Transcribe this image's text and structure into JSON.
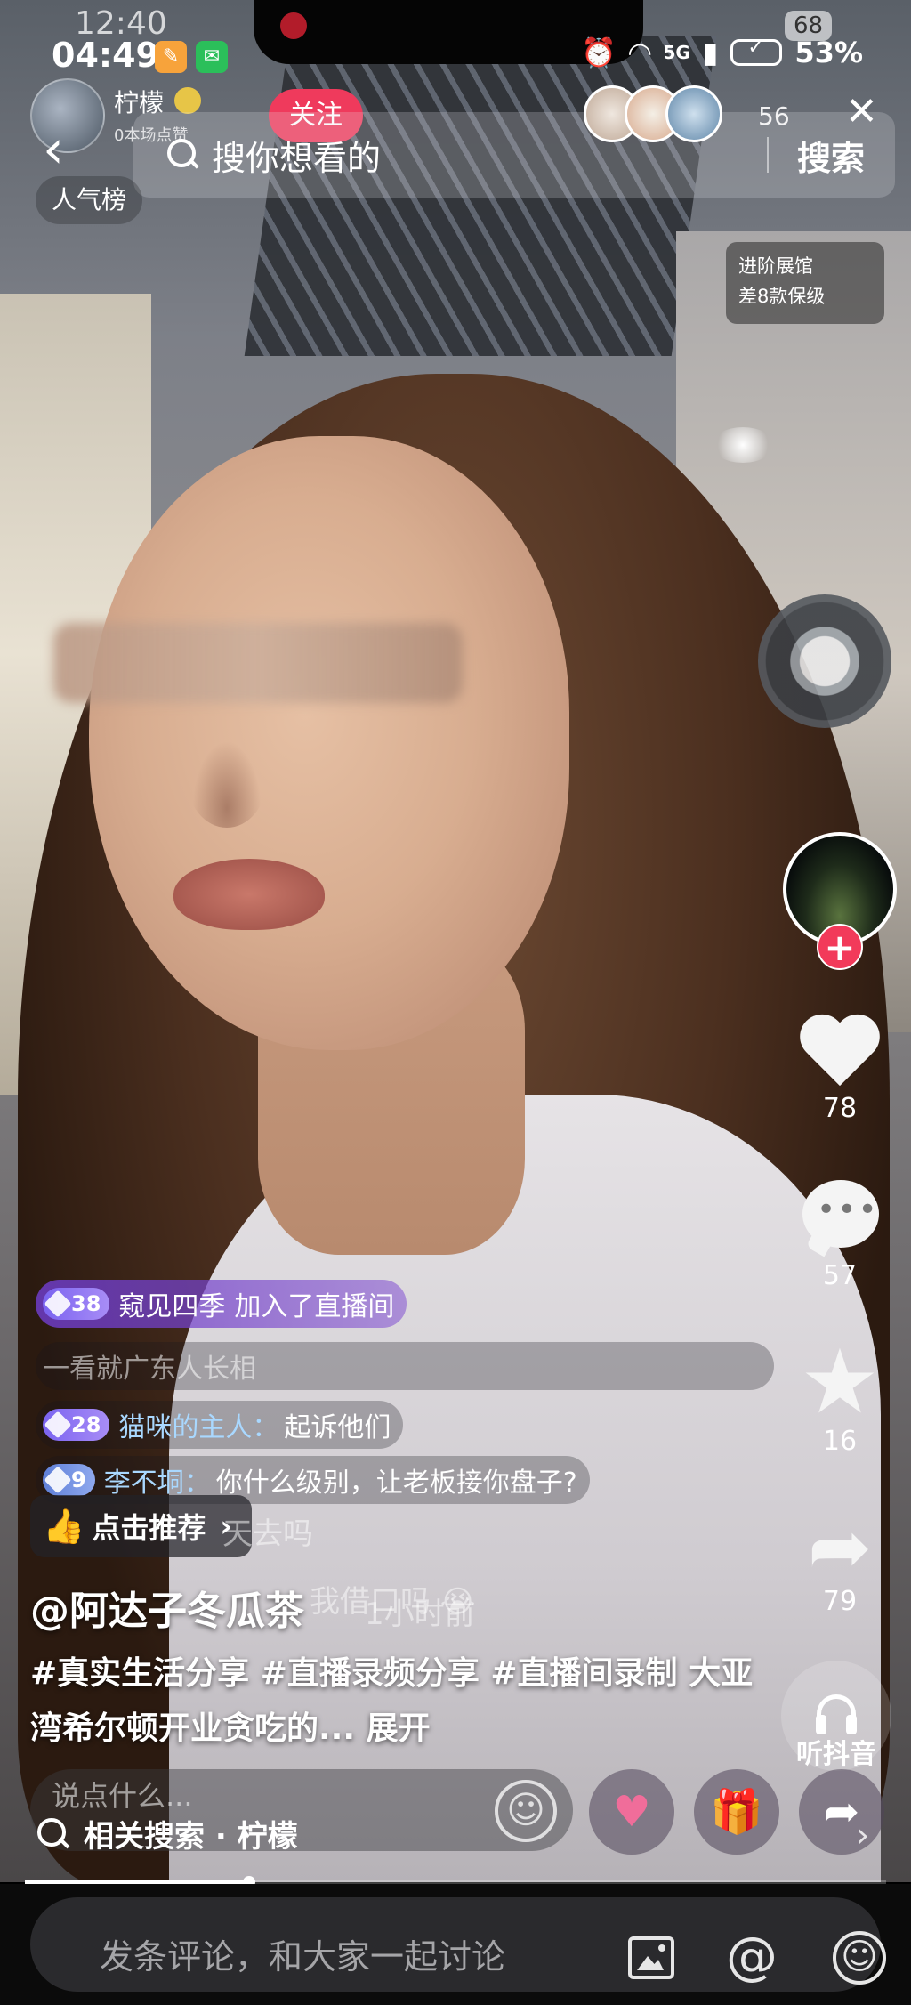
{
  "status_bar": {
    "ghost_time": "12:40",
    "time": "04:49",
    "ghost_battery": "68",
    "signal": "5G",
    "battery": "53%"
  },
  "live_header": {
    "anchor_name": "柠檬",
    "anchor_likes": "0本场点赞",
    "follow_label": "关注",
    "viewer_count": "56",
    "rank_label": "人气榜",
    "promo_line1": "进阶展馆",
    "promo_line2": "差8款保级"
  },
  "search": {
    "placeholder": "搜你想看的",
    "button_label": "搜索"
  },
  "actions": {
    "like_count": "78",
    "comment_count": "57",
    "favorite_count": "16",
    "share_count": "79",
    "listen_label": "听抖音",
    "plus": "+"
  },
  "chat": {
    "messages": [
      {
        "level": "38",
        "user": "窥见四季",
        "text": "加入了直播间"
      },
      {
        "level": "",
        "user": "",
        "text": "一看就广东人长相"
      },
      {
        "level": "28",
        "user": "猫咪的主人：",
        "text": "起诉他们"
      },
      {
        "level": "9",
        "user": "李不垌：",
        "text": "你什么级别，让老板接你盘子?"
      }
    ],
    "faded_tail": "天去吗",
    "faded_line": "我借口吗 😭"
  },
  "video": {
    "recommend_label": "点击推荐",
    "recommend_arrow": "›",
    "author": "@阿达子冬瓜茶",
    "caption": "#真实生活分享 #直播录频分享 #直播间录制 大亚湾希尔顿开业贪吃的...",
    "expand_label": "展开",
    "time_ago": "1小时前",
    "progress": 0.26
  },
  "live_input": {
    "placeholder": "说点什么..."
  },
  "related_search": {
    "label": "相关搜索 · 柠檬"
  },
  "composer": {
    "placeholder": "发条评论，和大家一起讨论"
  }
}
